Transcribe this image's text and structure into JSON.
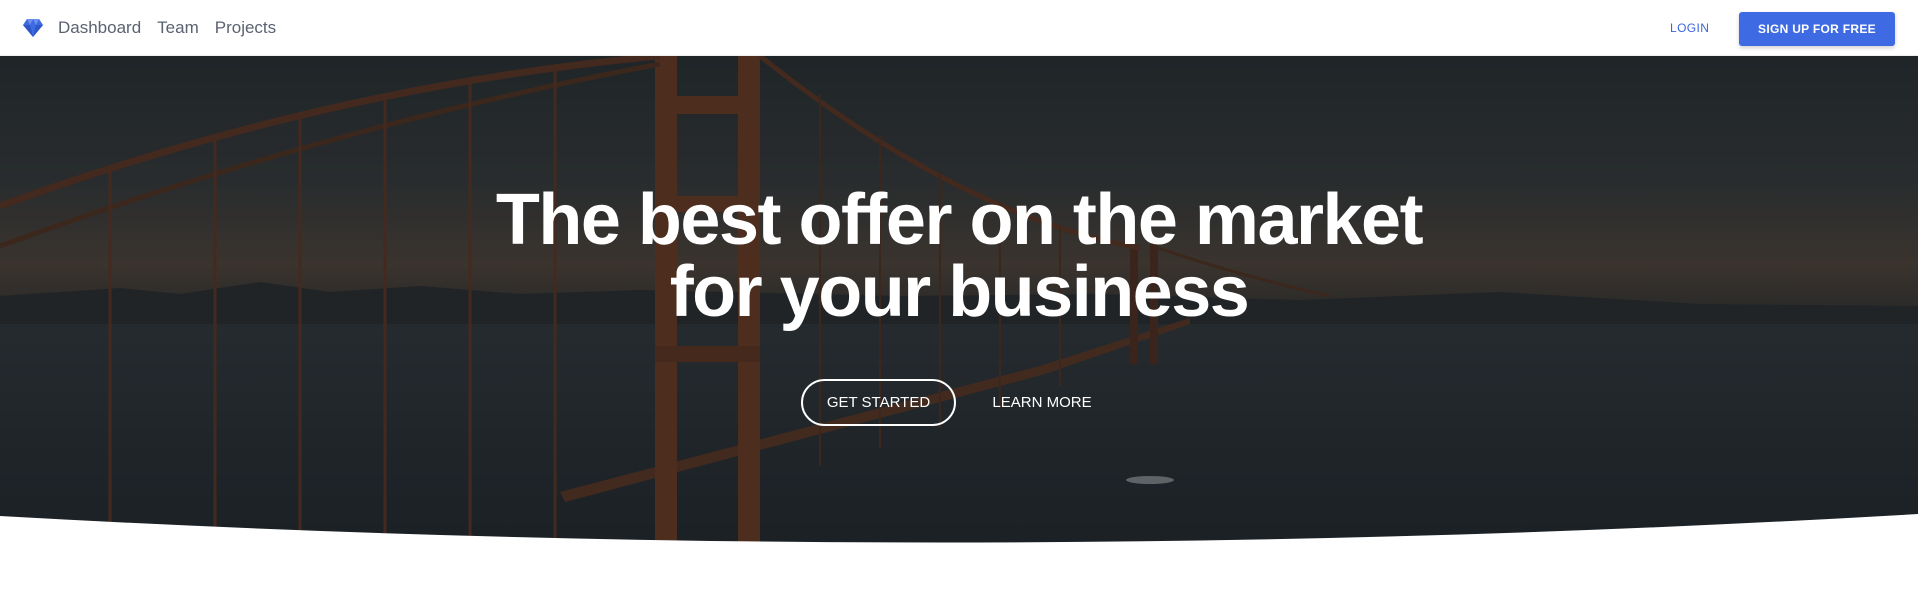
{
  "navbar": {
    "logo_icon": "diamond-icon",
    "links": [
      {
        "label": "Dashboard"
      },
      {
        "label": "Team"
      },
      {
        "label": "Projects"
      }
    ],
    "login_label": "LOGIN",
    "signup_label": "SIGN UP FOR FREE"
  },
  "hero": {
    "title_line1": "The best offer on the market",
    "title_line2": "for your business",
    "primary_button": "GET STARTED",
    "secondary_button": "LEARN MORE",
    "background": "bridge-photo"
  },
  "colors": {
    "accent": "#3e6ae3",
    "nav_text": "#5b6270",
    "hero_overlay": "#1c1f22"
  }
}
